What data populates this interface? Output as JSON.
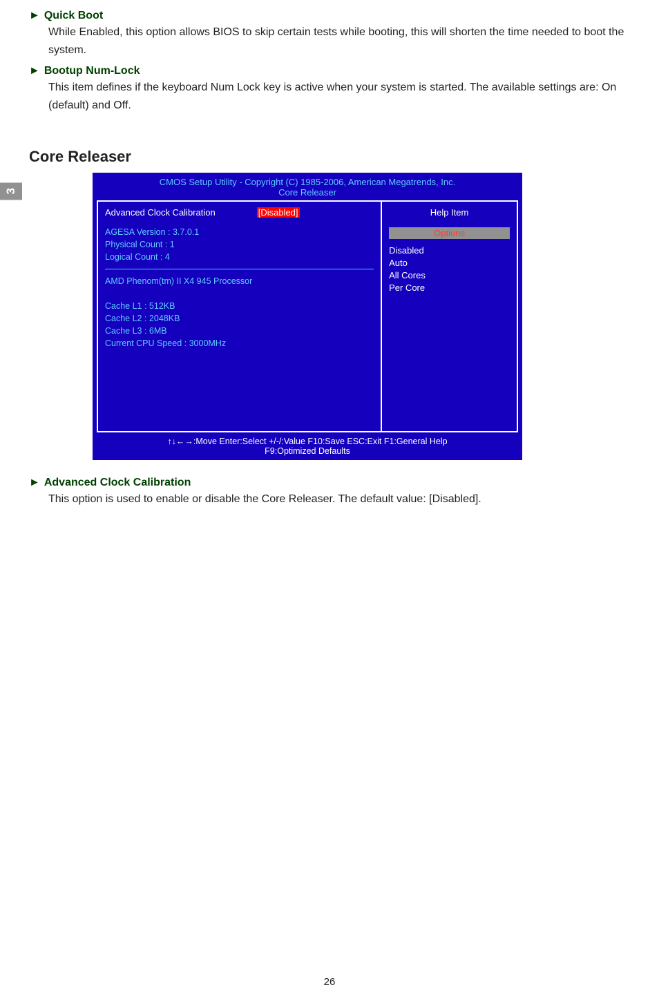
{
  "page_tab": "3",
  "items": {
    "quick_boot": {
      "title": "Quick Boot",
      "desc": "While Enabled, this option allows BIOS to skip certain tests while booting, this will shorten the time needed to boot the system."
    },
    "bootup_numlock": {
      "title": "Bootup Num-Lock",
      "desc": "This item defines if the keyboard Num Lock key is active when your system is started. The available settings are: On (default) and Off."
    },
    "adv_clock": {
      "title": "Advanced Clock Calibration",
      "desc": "This option is used to enable or disable the Core Releaser. The default value: [Disabled]."
    }
  },
  "section_heading": "Core Releaser",
  "bios": {
    "header_line1": "CMOS Setup Utility - Copyright (C) 1985-2006, American Megatrends, Inc.",
    "header_line2": "Core Releaser",
    "left": {
      "row_label": "Advanced Clock Calibration",
      "row_value": "[Disabled]",
      "agesa": "AGESA Version : 3.7.0.1",
      "phys": "Physical Count : 1",
      "logi": "Logical Count : 4",
      "proc": "AMD Phenom(tm) II X4 945 Processor",
      "l1": "Cache L1 : 512KB",
      "l2": "Cache L2 : 2048KB",
      "l3": "Cache L3 : 6MB",
      "speed": "Current CPU Speed    : 3000MHz"
    },
    "right": {
      "help_title": "Help Item",
      "options_hl": "Options",
      "opt1": "Disabled",
      "opt2": "Auto",
      "opt3": "All Cores",
      "opt4": "Per Core"
    },
    "keys": {
      "row1": "↑↓←→:Move   Enter:Select     +/-/:Value    F10:Save     ESC:Exit    F1:General Help",
      "row2": "F9:Optimized Defaults"
    }
  },
  "page_number": "26"
}
